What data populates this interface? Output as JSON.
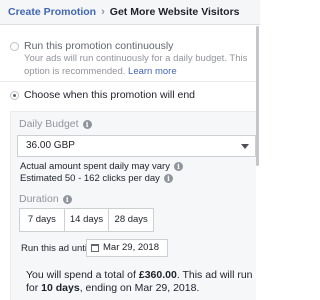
{
  "breadcrumb": {
    "parent": "Create Promotion",
    "separator": "›",
    "current": "Get More Website Visitors"
  },
  "schedule": {
    "continuous": {
      "title": "Run this promotion continuously",
      "desc": "Your ads will run continuously for a daily budget. This option is recommended.",
      "learn_more": "Learn more",
      "selected": false
    },
    "end_date": {
      "title": "Choose when this promotion will end",
      "selected": true
    }
  },
  "budget": {
    "label": "Daily Budget",
    "info_glyph": "i",
    "value": "36.00 GBP",
    "note1": "Actual amount spent daily may vary",
    "note2": "Estimated 50 - 162 clicks per day"
  },
  "duration": {
    "label": "Duration",
    "options": [
      "7 days",
      "14 days",
      "28 days"
    ],
    "run_until_label": "Run this ad until",
    "date": "Mar 29, 2018"
  },
  "summary": {
    "pre": "You will spend a total of ",
    "amount": "£360.00",
    "mid": ". This ad will run for ",
    "days": "10 days",
    "post": ", ending on Mar 29, 2018."
  },
  "colors": {
    "link": "#4267b2",
    "panel_bg": "#f6f7f9",
    "muted": "#90949c"
  }
}
